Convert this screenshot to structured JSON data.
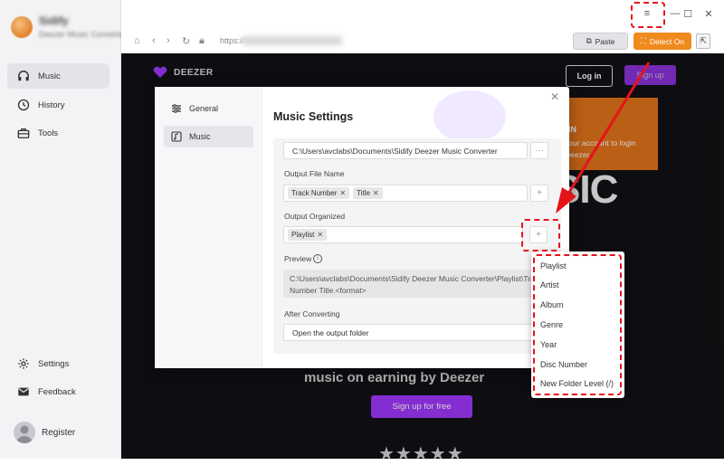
{
  "app": {
    "name": "Sidify",
    "subtitle": "Deezer Music Converter"
  },
  "sidebar": {
    "items": [
      {
        "label": "Music",
        "icon": "headphones-icon",
        "active": true
      },
      {
        "label": "History",
        "icon": "clock-icon",
        "active": false
      },
      {
        "label": "Tools",
        "icon": "toolbox-icon",
        "active": false
      }
    ],
    "bottom": [
      {
        "label": "Settings",
        "icon": "gear-icon"
      },
      {
        "label": "Feedback",
        "icon": "mail-icon"
      }
    ],
    "register_label": "Register"
  },
  "toolbar": {
    "url_prefix": "https://",
    "paste_label": "Paste",
    "detect_label": "Detect On"
  },
  "web": {
    "logo_text": "DEEZER",
    "login_label": "Log in",
    "signup_top_label": "Sign up",
    "popup_title": "IN",
    "popup_line1": "your account to login",
    "popup_line2": "Deezer",
    "big_text_line1": "SIC",
    "big_text_line2": "",
    "tagline": "music on earning by Deezer",
    "signup_free_label": "Sign up for free",
    "stars": "★★★★★"
  },
  "dialog": {
    "nav": [
      {
        "label": "General",
        "icon": "sliders-icon",
        "active": false
      },
      {
        "label": "Music",
        "icon": "music-note-icon",
        "active": true
      }
    ],
    "title": "Music Settings",
    "output_folder_value": "C:\\Users\\avclabs\\Documents\\Sidify Deezer Music Converter",
    "browse_label": "···",
    "output_file_name_label": "Output File Name",
    "file_name_chips": [
      "Track Number",
      "Title"
    ],
    "output_organized_label": "Output Organized",
    "organized_chips": [
      "Playlist"
    ],
    "add_label": "+",
    "preview_label": "Preview",
    "preview_line1": "C:\\Users\\avclabs\\Documents\\Sidify Deezer Music Converter\\Playlist\\Track",
    "preview_line2": "Number Title.<format>",
    "after_converting_label": "After Converting",
    "after_converting_value": "Open the output folder",
    "close_label": "✕"
  },
  "dropdown": {
    "options": [
      "Playlist",
      "Artist",
      "Album",
      "Genre",
      "Year",
      "Disc Number",
      "New Folder Level (/)"
    ]
  },
  "colors": {
    "accent_orange": "#f08a1d",
    "annotation_red": "#e5141b",
    "deezer_purple": "#a238ff"
  }
}
